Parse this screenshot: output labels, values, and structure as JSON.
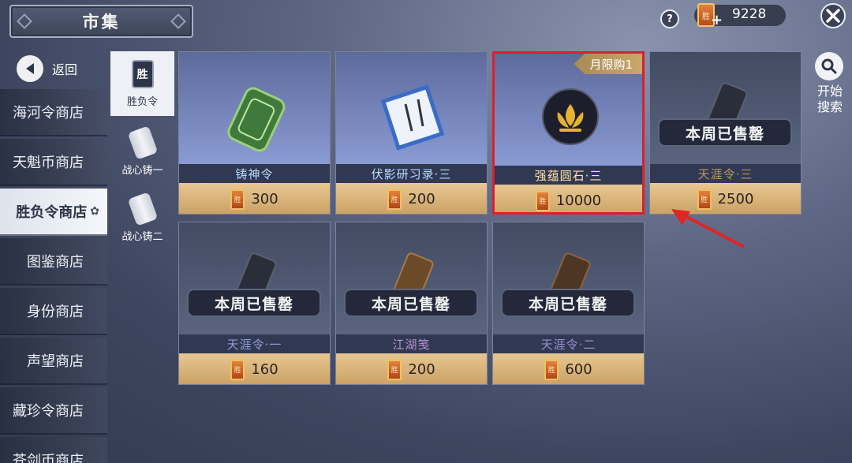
{
  "header": {
    "title": "市集"
  },
  "topbar": {
    "help_label": "?",
    "currency_amount": "9228",
    "currency_plus": "+",
    "currency_icon_text": "胜"
  },
  "back": {
    "label": "返回"
  },
  "sidebar": {
    "items": [
      {
        "label": "海河令商店"
      },
      {
        "label": "天魁币商店"
      },
      {
        "label": "胜负令商店",
        "active": true
      },
      {
        "label": "图鉴商店"
      },
      {
        "label": "身份商店"
      },
      {
        "label": "声望商店"
      },
      {
        "label": "藏珍令商店"
      },
      {
        "label": "苍剑币商店"
      }
    ]
  },
  "subtabs": [
    {
      "label": "胜负令",
      "icon_text": "胜",
      "active": true
    },
    {
      "label": "战心铸一"
    },
    {
      "label": "战心铸二"
    }
  ],
  "price_icon_text": "胜",
  "items": [
    {
      "name": "铸神令",
      "price": "300",
      "name_color": "#b9dcff"
    },
    {
      "name": "伏影研习录·三",
      "price": "200",
      "name_color": "#b9dcff"
    },
    {
      "name": "强蕴圆石·三",
      "price": "10000",
      "name_color": "#ffe4a6",
      "limit": "月限购1",
      "highlighted": true
    },
    {
      "name": "天涯令·三",
      "price": "2500",
      "name_color": "#b99a60",
      "soldout": "本周已售罄"
    },
    {
      "name": "天涯令·一",
      "price": "160",
      "name_color": "#8d9fd8",
      "soldout": "本周已售罄"
    },
    {
      "name": "江湖笺",
      "price": "200",
      "name_color": "#b98fd0",
      "soldout": "本周已售罄"
    },
    {
      "name": "天涯令·二",
      "price": "600",
      "name_color": "#9a8fd0",
      "soldout": "本周已售罄"
    }
  ],
  "search": {
    "label": "开始搜索"
  },
  "colors": {
    "highlight_border": "#d9202e",
    "arrow": "#e02525"
  }
}
